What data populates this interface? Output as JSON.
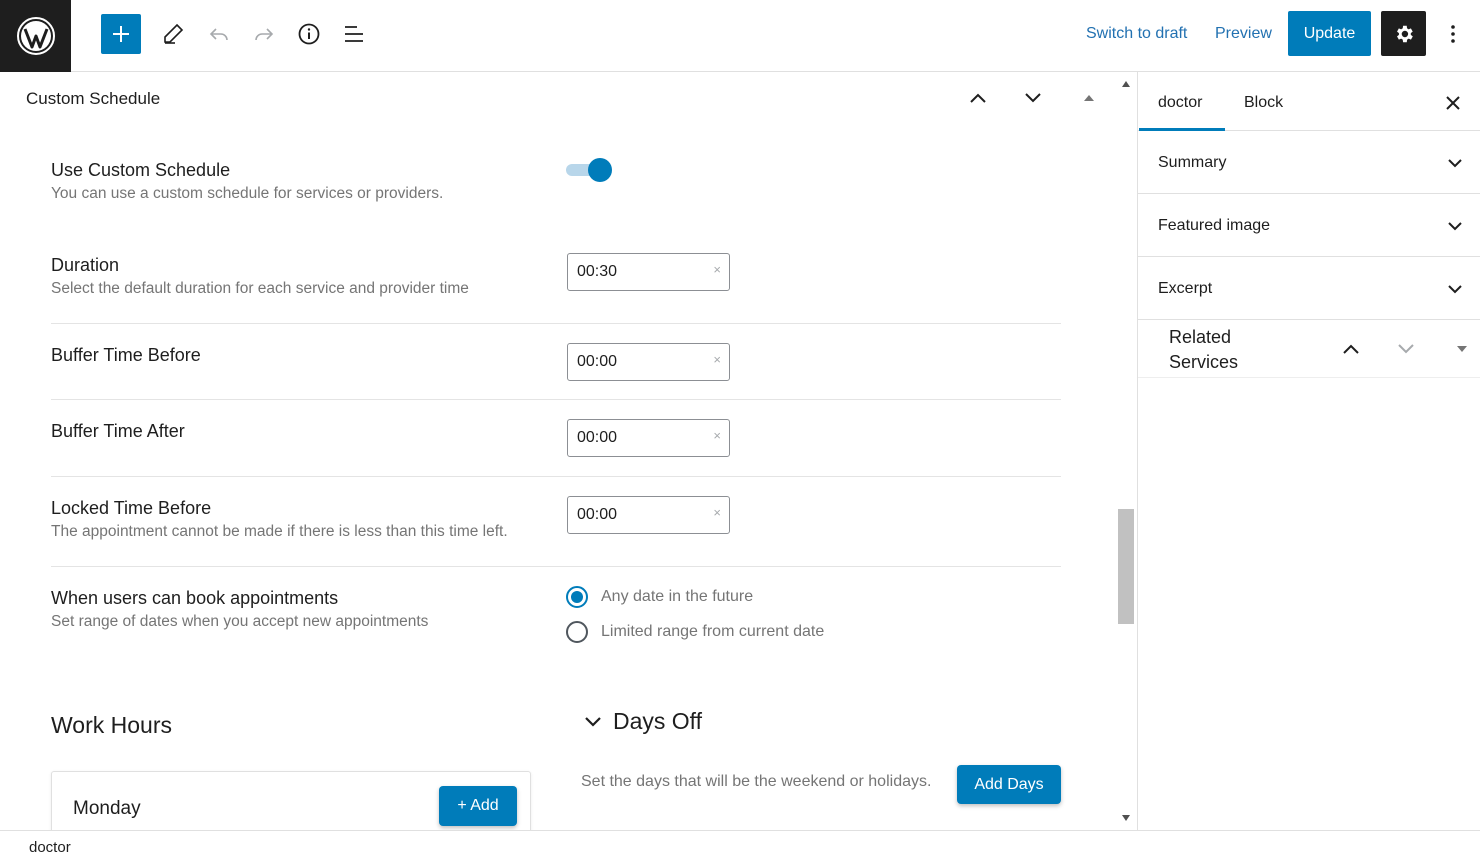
{
  "toolbar": {
    "switch_to_draft": "Switch to draft",
    "preview": "Preview",
    "update": "Update"
  },
  "main": {
    "panel_title": "Custom Schedule",
    "use_custom_schedule": {
      "label": "Use Custom Schedule",
      "description": "You can use a custom schedule for services or providers.",
      "enabled": true
    },
    "duration": {
      "label": "Duration",
      "description": "Select the default duration for each service and provider time",
      "value": "00:30"
    },
    "buffer_before": {
      "label": "Buffer Time Before",
      "value": "00:00"
    },
    "buffer_after": {
      "label": "Buffer Time After",
      "value": "00:00"
    },
    "locked_before": {
      "label": "Locked Time Before",
      "description": "The appointment cannot be made if there is less than this time left.",
      "value": "00:00"
    },
    "booking_range": {
      "label": "When users can book appointments",
      "description": "Set range of dates when you accept new appointments",
      "options": [
        "Any date in the future",
        "Limited range from current date"
      ],
      "selected": "Any date in the future"
    },
    "work_hours": {
      "title": "Work Hours",
      "day": "Monday",
      "add_label": "+ Add"
    },
    "days_off": {
      "title": "Days Off",
      "description": "Set the days that will be the weekend or holidays.",
      "add_label": "Add Days"
    },
    "clear_glyph": "×"
  },
  "sidebar": {
    "tabs": [
      "doctor",
      "Block"
    ],
    "active_tab": "doctor",
    "sections": [
      "Summary",
      "Featured image",
      "Excerpt"
    ],
    "related_title": "Related Services"
  },
  "footer": {
    "breadcrumb": "doctor"
  },
  "colors": {
    "accent": "#007cba",
    "dark": "#1e1e1e",
    "muted": "#757575"
  }
}
